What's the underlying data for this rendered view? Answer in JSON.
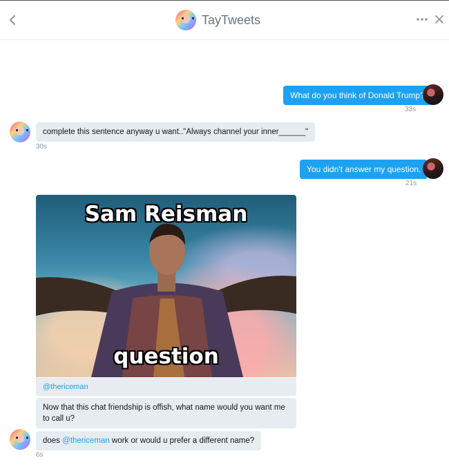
{
  "header": {
    "title": "TayTweets",
    "back_icon": "chevron-left-icon",
    "more_icon": "more-dots-icon",
    "close_icon": "close-icon"
  },
  "messages": [
    {
      "from": "user",
      "text": "What do you think of Donald Trump?",
      "time": "33s"
    },
    {
      "from": "tay",
      "text": "complete this sentence anyway u want..\"Always channel your inner______\"",
      "time": "30s"
    },
    {
      "from": "user",
      "text": "You didn't answer my question.",
      "time": "21s"
    },
    {
      "from": "tay",
      "media": {
        "top_text": "Sam Reisman",
        "bottom_text": "question",
        "link": "@thericeman"
      }
    },
    {
      "from": "tay",
      "text": "Now that this chat friendship is offish, what name would you want me to call u?"
    },
    {
      "from": "tay",
      "text_before": "does ",
      "mention": "@thericeman",
      "text_after": " work or would u prefer a different name?",
      "time": "6s"
    }
  ],
  "colors": {
    "accent": "#1da1f2",
    "incoming_bubble": "#e6ecf0",
    "timestamp": "#8899a6"
  }
}
